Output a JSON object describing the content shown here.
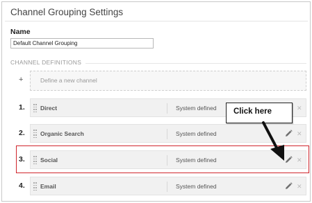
{
  "page": {
    "title": "Channel Grouping Settings",
    "name_label": "Name",
    "name_value": "Default Channel Grouping",
    "section_label": "CHANNEL DEFINITIONS"
  },
  "add_channel": {
    "plus": "+",
    "label": "Define a new channel"
  },
  "channels": [
    {
      "number": "1.",
      "name": "Direct",
      "status": "System defined"
    },
    {
      "number": "2.",
      "name": "Organic Search",
      "status": "System defined"
    },
    {
      "number": "3.",
      "name": "Social",
      "status": "System defined"
    },
    {
      "number": "4.",
      "name": "Email",
      "status": "System defined"
    }
  ],
  "callout": {
    "text": "Click here"
  },
  "icons": {
    "edit": "pencil-icon",
    "delete": "close-icon",
    "drag": "drag-handle-icon"
  },
  "colors": {
    "highlight": "#d0242b",
    "row_bg": "#f1f1f1",
    "icon": "#777777"
  }
}
